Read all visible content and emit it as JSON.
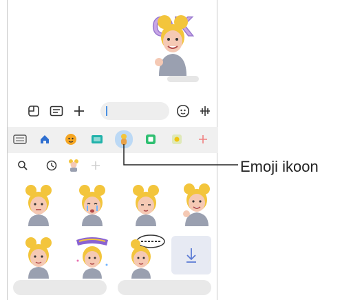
{
  "callout": {
    "label": "Emoji ikoon"
  },
  "chat": {
    "sticker_text": "OK"
  },
  "composer": {
    "icons": [
      "sticker-icon",
      "image-icon",
      "plus-icon",
      "emoji-face-icon",
      "voice-icon"
    ],
    "input_value": ""
  },
  "emoji_tabs": {
    "icons": [
      "keyboard-icon",
      "home-icon",
      "face-icon",
      "gif-icon",
      "emoji-avatar-icon",
      "square-icon",
      "sparkle-icon",
      "plus-icon"
    ],
    "selected": "emoji-avatar-icon"
  },
  "sticker_subtabs": {
    "icons": [
      "search-icon",
      "recent-icon",
      "avatar-icon",
      "add-icon"
    ]
  },
  "stickers": {
    "row1": [
      "neutral",
      "crying",
      "eyes-closed",
      "waving"
    ],
    "row2": [
      "smiling",
      "thanks-text",
      "speech-bubble",
      "download"
    ]
  },
  "colors": {
    "accent": "#4a90e2",
    "selected_tab": "#bcd9f5",
    "hair": "#f3c53c",
    "skin": "#f5c9b4",
    "shirt": "#9aa0b0",
    "ok_text": "#c8a6e6",
    "leader": "#222222"
  }
}
